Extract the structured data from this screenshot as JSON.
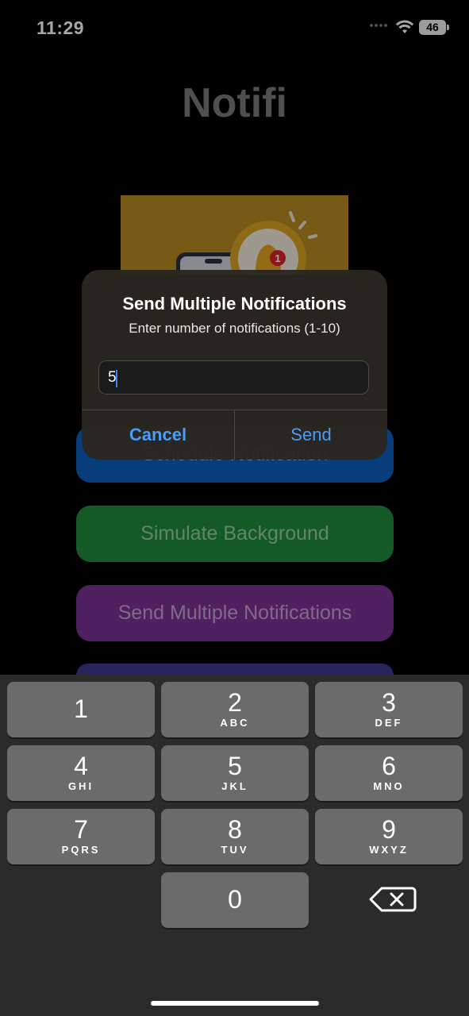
{
  "status_bar": {
    "time": "11:29",
    "battery": "46"
  },
  "app": {
    "title": "Notifi"
  },
  "hero": {
    "badge_count": "1"
  },
  "buttons": {
    "schedule": "Schedule Notification",
    "background": "Simulate Background",
    "multiple": "Send Multiple Notifications"
  },
  "alert": {
    "title": "Send Multiple Notifications",
    "message": "Enter number of notifications (1-10)",
    "input_value": "5",
    "cancel_label": "Cancel",
    "send_label": "Send"
  },
  "keyboard": {
    "keys": [
      {
        "digit": "1",
        "letters": ""
      },
      {
        "digit": "2",
        "letters": "ABC"
      },
      {
        "digit": "3",
        "letters": "DEF"
      },
      {
        "digit": "4",
        "letters": "GHI"
      },
      {
        "digit": "5",
        "letters": "JKL"
      },
      {
        "digit": "6",
        "letters": "MNO"
      },
      {
        "digit": "7",
        "letters": "PQRS"
      },
      {
        "digit": "8",
        "letters": "TUV"
      },
      {
        "digit": "9",
        "letters": "WXYZ"
      },
      {
        "digit": "0",
        "letters": ""
      }
    ],
    "delete_icon": "backspace-icon"
  },
  "colors": {
    "accent_blue": "#4a9cf5",
    "schedule_button": "#0b5fbd",
    "background_button": "#1f8a3c",
    "multiple_button": "#7a3494"
  }
}
